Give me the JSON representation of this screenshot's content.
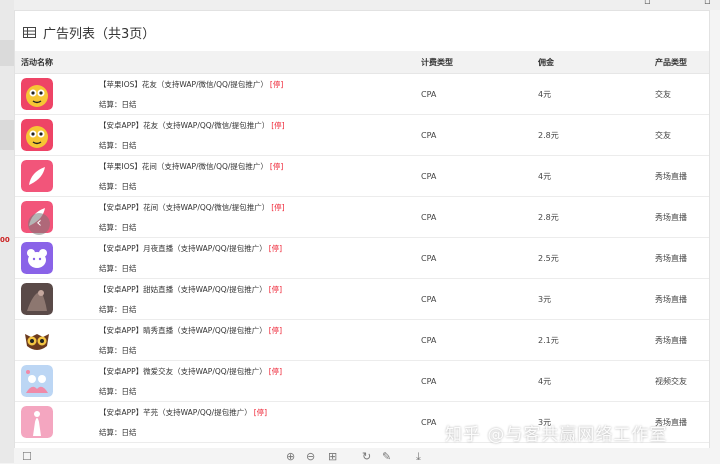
{
  "page": {
    "title": "广告列表（共3页）",
    "left_label": "00"
  },
  "table": {
    "headers": [
      "活动名称",
      "计费类型",
      "佣金",
      "产品类型"
    ],
    "settle_label": "结算：",
    "rows": [
      {
        "name": "【苹果IOS】花友（支持WAP/微信/QQ/提包推广）",
        "tag": "[停]",
        "settle": "日结",
        "billing": "CPA",
        "commission": "4元",
        "product": "交友",
        "thumb": "owl-yellow-icon"
      },
      {
        "name": "【安卓APP】花友（支持WAP/QQ/微信/提包推广）",
        "tag": "[停]",
        "settle": "日结",
        "billing": "CPA",
        "commission": "2.8元",
        "product": "交友",
        "thumb": "owl-yellow-icon"
      },
      {
        "name": "【苹果IOS】花间（支持WAP/微信/QQ/提包推广）",
        "tag": "[停]",
        "settle": "日结",
        "billing": "CPA",
        "commission": "4元",
        "product": "秀场直播",
        "thumb": "feather-pink-icon"
      },
      {
        "name": "【安卓APP】花间（支持WAP/QQ/微信/提包推广）",
        "tag": "[停]",
        "settle": "日结",
        "billing": "CPA",
        "commission": "2.8元",
        "product": "秀场直播",
        "thumb": "feather-pink-icon"
      },
      {
        "name": "【安卓APP】月夜直播（支持WAP/QQ/提包推广）",
        "tag": "[停]",
        "settle": "日结",
        "billing": "CPA",
        "commission": "2.5元",
        "product": "秀场直播",
        "thumb": "bear-purple-icon"
      },
      {
        "name": "【安卓APP】甜姑直播（支持WAP/QQ/提包推广）",
        "tag": "[停]",
        "settle": "日结",
        "billing": "CPA",
        "commission": "3元",
        "product": "秀场直播",
        "thumb": "photo-dark-icon"
      },
      {
        "name": "【安卓APP】睛秀直播（支持WAP/QQ/提包推广）",
        "tag": "[停]",
        "settle": "日结",
        "billing": "CPA",
        "commission": "2.1元",
        "product": "秀场直播",
        "thumb": "owl-eyes-icon"
      },
      {
        "name": "【安卓APP】微爱交友（支持WAP/QQ/提包推广）",
        "tag": "[停]",
        "settle": "日结",
        "billing": "CPA",
        "commission": "4元",
        "product": "视频交友",
        "thumb": "couple-blue-icon"
      },
      {
        "name": "【安卓APP】芊芫（支持WAP/QQ/提包推广）",
        "tag": "[停]",
        "settle": "日结",
        "billing": "CPA",
        "commission": "3元",
        "product": "秀场直播",
        "thumb": "figure-pink-icon"
      }
    ]
  },
  "watermark": "知乎 @与客共赢网络工作室",
  "colors": {
    "tag": "#e23333",
    "header_bg": "#f2f2f2"
  }
}
